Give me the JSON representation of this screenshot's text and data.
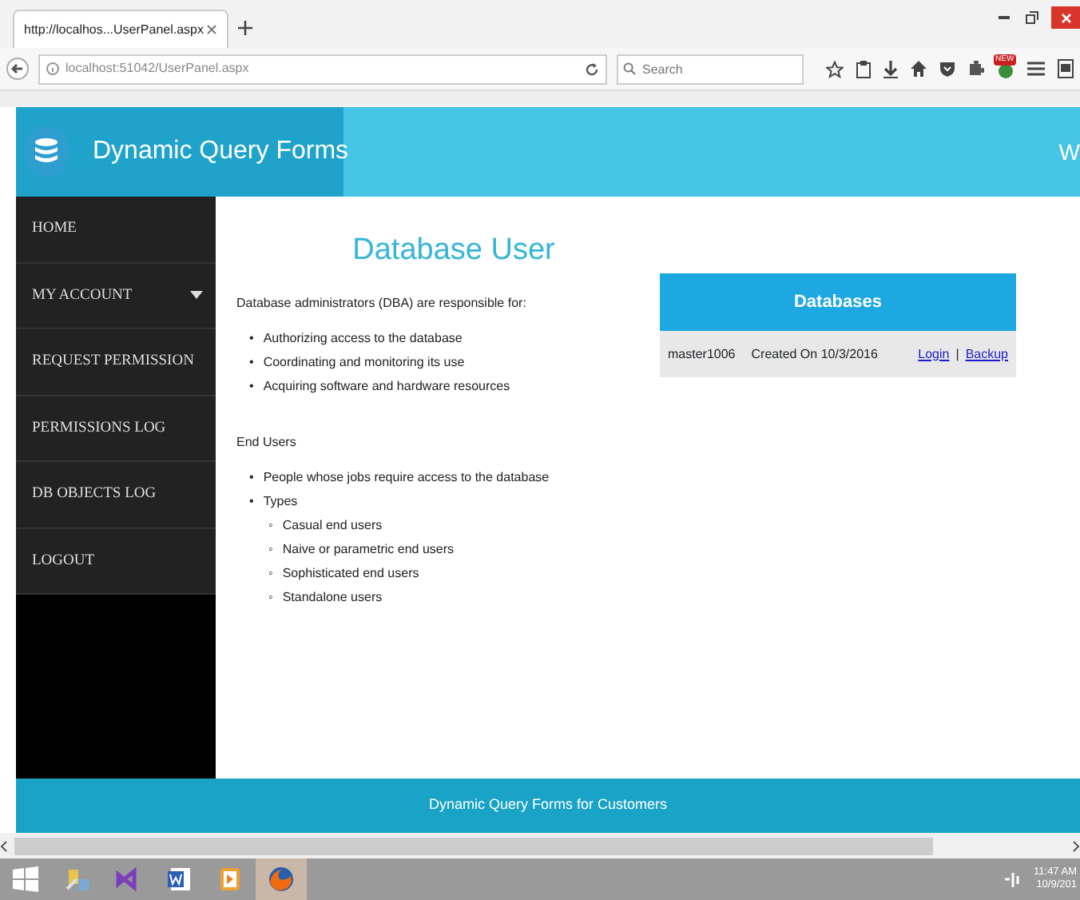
{
  "browser": {
    "tab_title": "http://localhos...UserPanel.aspx",
    "address": "localhost:51042/UserPanel.aspx",
    "search": {
      "placeholder": "Search"
    },
    "badge": "NEW"
  },
  "header": {
    "brand": "Dynamic Query Forms",
    "right_text": "W"
  },
  "sidebar": {
    "items": [
      {
        "label": "HOME",
        "kind": "link"
      },
      {
        "label": "MY ACCOUNT",
        "kind": "dropdown"
      },
      {
        "label": "REQUEST PERMISSION",
        "kind": "link"
      },
      {
        "label": "PERMISSIONS LOG",
        "kind": "link"
      },
      {
        "label": "DB OBJECTS LOG",
        "kind": "link"
      },
      {
        "label": "LOGOUT",
        "kind": "link"
      }
    ]
  },
  "content": {
    "title": "Database User",
    "sections": [
      {
        "intro": "Database administrators (DBA) are responsible for:",
        "items": [
          {
            "marker": "•",
            "text": "Authorizing access to the database"
          },
          {
            "marker": "•",
            "text": "Coordinating and monitoring its use"
          },
          {
            "marker": "•",
            "text": "Acquiring software and hardware resources"
          }
        ]
      },
      {
        "intro": "End Users",
        "items": [
          {
            "marker": "•",
            "text": "People whose jobs require access to the database"
          },
          {
            "marker": "•",
            "text": "Types",
            "children": [
              {
                "marker": "◦",
                "text": "Casual end users"
              },
              {
                "marker": "◦",
                "text": "Naive or parametric end users"
              },
              {
                "marker": "◦",
                "text": "Sophisticated end users"
              },
              {
                "marker": "◦",
                "text": "Standalone users"
              }
            ]
          }
        ]
      }
    ]
  },
  "databases": {
    "title": "Databases",
    "rows": [
      {
        "name": "master1006",
        "created": "Created On 10/3/2016",
        "links": [
          "Login",
          "Backup"
        ],
        "separator": "|"
      }
    ]
  },
  "footer": "Dynamic Query Forms for Customers",
  "taskbar": {
    "apps": [
      {
        "kind": "tools",
        "selected": false
      },
      {
        "kind": "studio",
        "selected": false
      },
      {
        "kind": "word",
        "selected": false
      },
      {
        "kind": "player",
        "selected": false
      },
      {
        "kind": "browser",
        "selected": true
      }
    ],
    "time": "11:47 AM",
    "date": "10/9/201"
  }
}
